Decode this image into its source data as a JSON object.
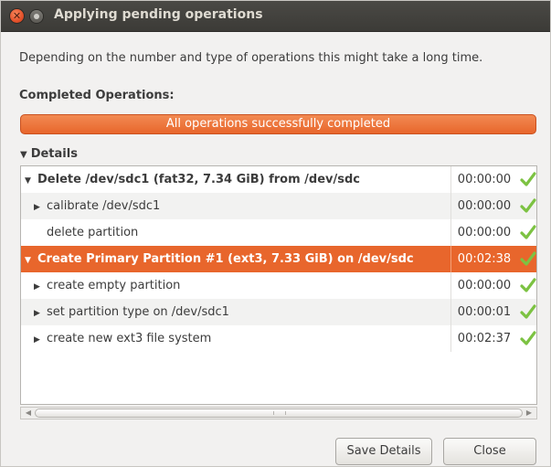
{
  "window": {
    "title": "Applying pending operations",
    "close_glyph": "✕"
  },
  "description": "Depending on the number and type of operations this might take a long time.",
  "completed_label": "Completed Operations:",
  "progress": {
    "text": "All operations successfully completed",
    "fraction": 1.0,
    "color": "#e8662c"
  },
  "details": {
    "label": "Details",
    "rows": [
      {
        "name": "Delete /dev/sdc1 (fat32, 7.34 GiB) from /dev/sdc",
        "time": "00:00:00",
        "status": "success-check-icon",
        "level": 0,
        "expanded": true
      },
      {
        "name": "calibrate /dev/sdc1",
        "time": "00:00:00",
        "status": "success-check-icon",
        "level": 1,
        "expanded": false
      },
      {
        "name": "delete partition",
        "time": "00:00:00",
        "status": "success-check-icon",
        "level": 1,
        "expanded": null
      },
      {
        "name": "Create Primary Partition #1 (ext3, 7.33 GiB) on /dev/sdc",
        "time": "00:02:38",
        "status": "success-check-icon",
        "level": 0,
        "expanded": true,
        "selected": true
      },
      {
        "name": "create empty partition",
        "time": "00:00:00",
        "status": "success-check-icon",
        "level": 1,
        "expanded": false
      },
      {
        "name": "set partition type on /dev/sdc1",
        "time": "00:00:01",
        "status": "success-check-icon",
        "level": 1,
        "expanded": false
      },
      {
        "name": "create new ext3 file system",
        "time": "00:02:37",
        "status": "success-check-icon",
        "level": 1,
        "expanded": false
      }
    ]
  },
  "buttons": {
    "save_details": "Save Details",
    "close": "Close"
  },
  "colors": {
    "accent": "#e8662c",
    "check": "#7cc242"
  }
}
